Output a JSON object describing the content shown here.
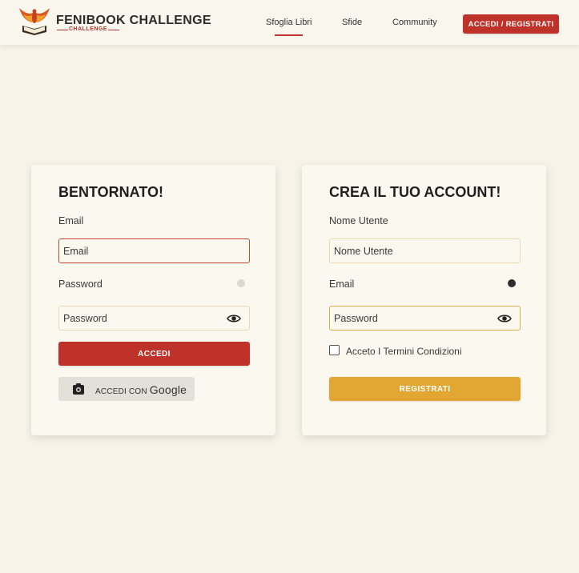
{
  "header": {
    "brand_title": "FENIBOOK CHALLENGE",
    "brand_sub": "CHALLENGE",
    "nav": [
      "Sfoglia Libri",
      "Sfide",
      "Community"
    ],
    "cta_label": "ACCEDI / REGISTRATI"
  },
  "login": {
    "title": "BENTORNATO!",
    "email_label": "Email",
    "email_placeholder": "Email",
    "password_label": "Password",
    "password_placeholder": "Password",
    "submit_label": "ACCEDI",
    "google_prefix": "ACCEDI CON",
    "google_brand": "Google"
  },
  "register": {
    "title": "CREA IL TUO ACCOUNT!",
    "username_label": "Nome Utente",
    "username_placeholder": "Nome Utente",
    "email_label": "Email",
    "password_placeholder": "Password",
    "terms_label": "Acceto I Termini Condizioni",
    "submit_label": "REGISTRATI"
  },
  "colors": {
    "brand_red": "#bf322a",
    "accent_gold": "#e2a632",
    "background": "#f7f3e8"
  }
}
